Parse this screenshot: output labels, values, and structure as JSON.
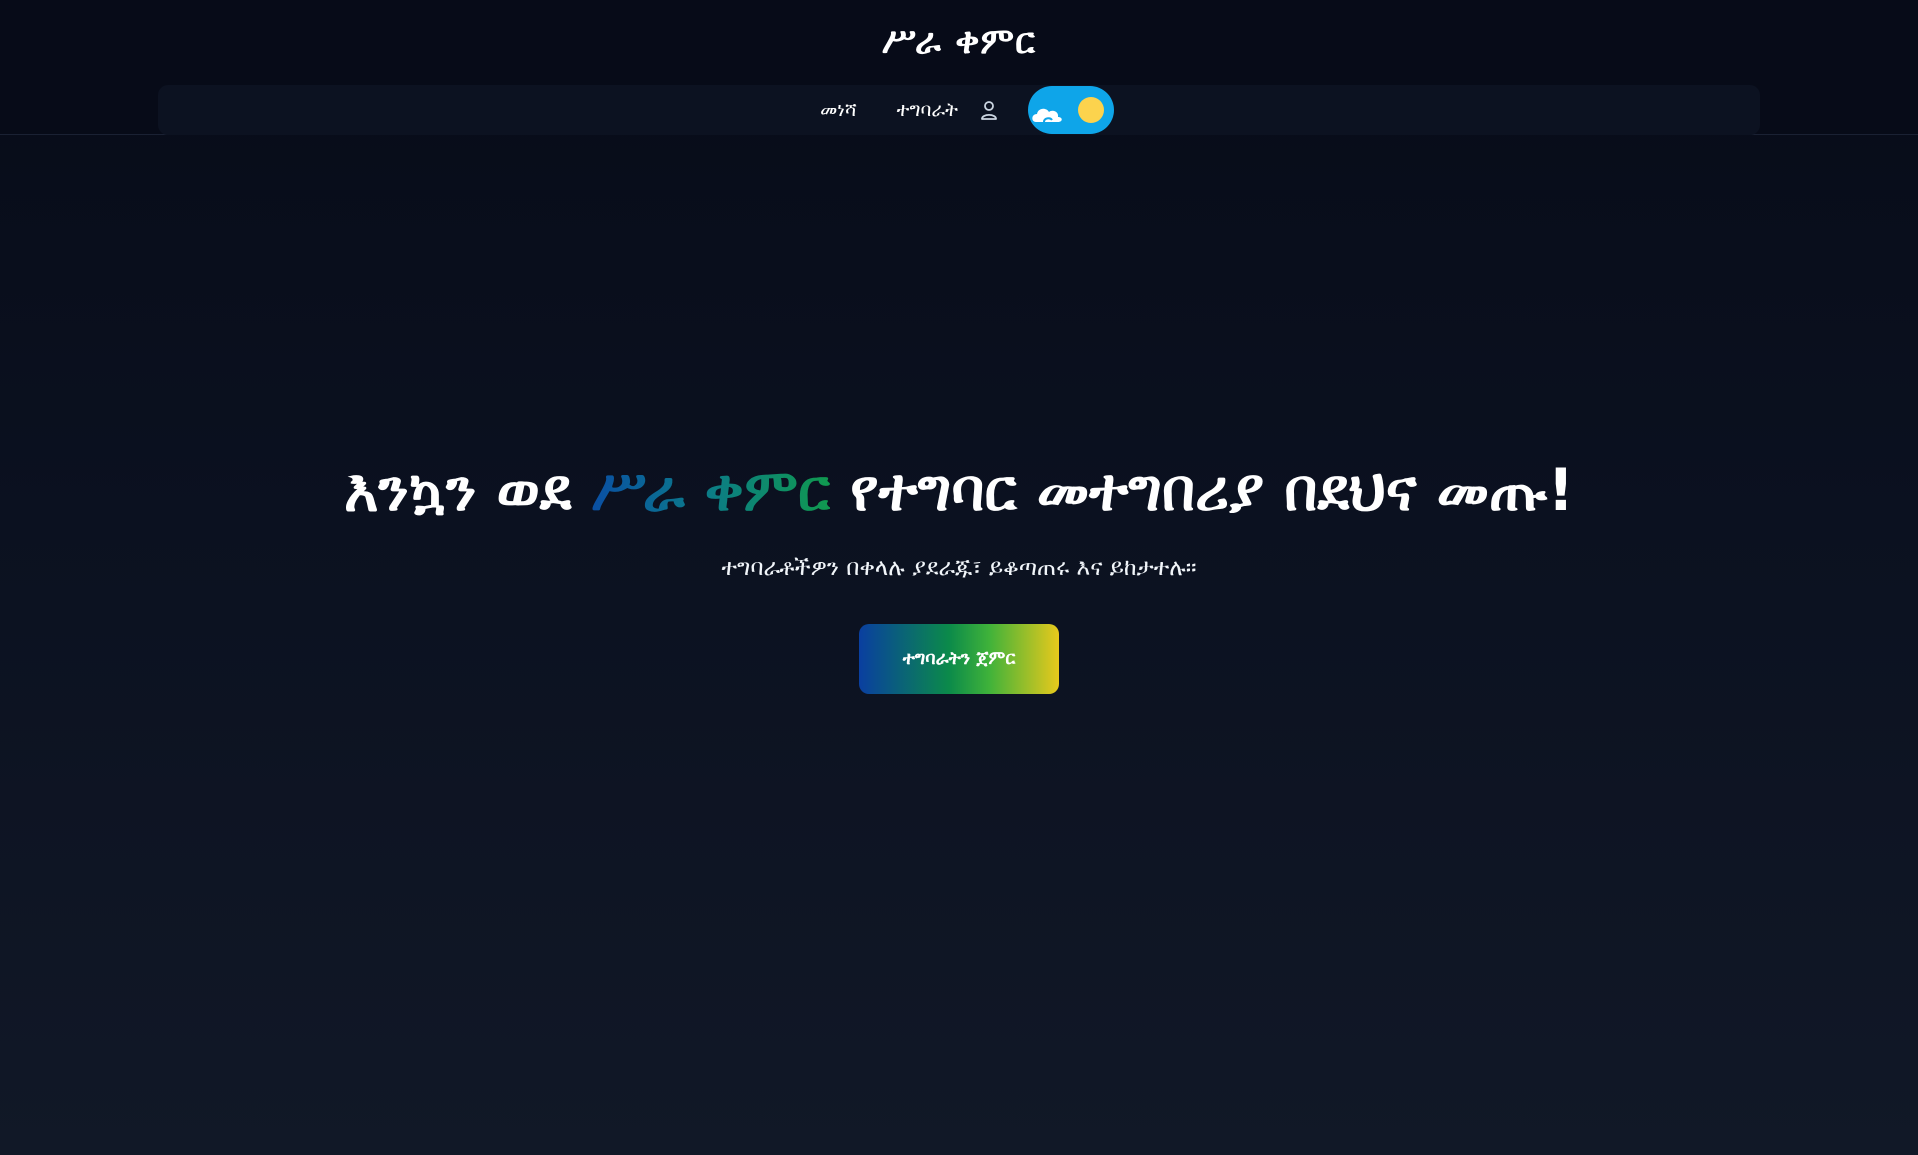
{
  "header": {
    "brand": "ሥራ ቀምር",
    "nav": {
      "home_label": "መነሻ",
      "tasks_label": "ተግባራት"
    },
    "theme_toggle": {
      "state": "light"
    }
  },
  "hero": {
    "title_prefix": "እንኳን ወደ",
    "title_brand": "ሥራ ቀምር",
    "title_suffix": "የተግባር መተግበሪያ በደህና መጡ!",
    "subtitle": "ተግባራቶችዎን በቀላሉ ያደራጁ፣ ይቆጣጠሩ እና ይከታተሉ።",
    "cta_label": "ተግባራትን ጀምር"
  },
  "colors": {
    "background": "#0b1120",
    "header_bg": "#070b18",
    "navbar_bg": "#0c1221",
    "toggle_bg": "#0ea5e9",
    "sun": "#fcd34d",
    "brand_gradient": [
      "#0a4fa3",
      "#0b7a8a",
      "#10994f"
    ],
    "cta_gradient": [
      "#0a3fa0",
      "#0b8a4a",
      "#3fb23a",
      "#e8c91c"
    ]
  },
  "icons": {
    "user": "user-icon",
    "cloud": "cloud-icon",
    "sun": "sun-icon"
  }
}
